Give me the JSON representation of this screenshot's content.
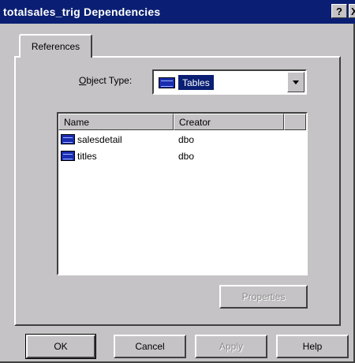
{
  "window": {
    "title": "totalsales_trig Dependencies",
    "help_glyph": "?",
    "close_glyph": "X"
  },
  "tab": {
    "label": "References"
  },
  "object_type": {
    "label_accesskey": "O",
    "label_rest": "bject Type:",
    "selected": "Tables",
    "icon": "table-icon"
  },
  "list": {
    "columns": [
      "Name",
      "Creator"
    ],
    "rows": [
      {
        "name": "salesdetail",
        "creator": "dbo",
        "icon": "table-icon"
      },
      {
        "name": "titles",
        "creator": "dbo",
        "icon": "table-icon"
      }
    ]
  },
  "buttons": {
    "properties": "Properties",
    "ok": "OK",
    "cancel": "Cancel",
    "apply": "Apply",
    "help": "Help"
  },
  "colors": {
    "titlebar": "#0a1f73",
    "face": "#c6c3c6",
    "selection": "#0a1f73"
  }
}
